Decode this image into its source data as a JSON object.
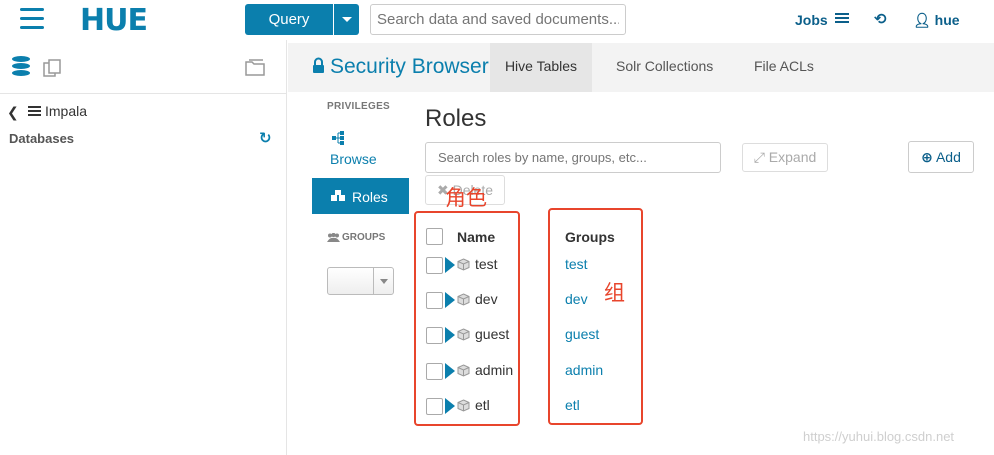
{
  "topbar": {
    "logo_text": "HUE",
    "query_label": "Query",
    "search_placeholder": "Search data and saved documents...",
    "jobs_label": "Jobs",
    "user_label": "hue"
  },
  "leftpanel": {
    "back_label": "Impala",
    "databases_label": "Databases"
  },
  "security": {
    "title": "Security Browser",
    "tabs": [
      {
        "label": "Hive Tables",
        "active": true
      },
      {
        "label": "Solr Collections",
        "active": false
      },
      {
        "label": "File ACLs",
        "active": false
      }
    ]
  },
  "sidenav": {
    "privileges_label": "PRIVILEGES",
    "browse_label": "Browse",
    "roles_label": "Roles",
    "groups_label": "GROUPS",
    "groups_select_value": ""
  },
  "content": {
    "title": "Roles",
    "search_placeholder": "Search roles by name, groups, etc...",
    "expand_label": "Expand",
    "add_label": "Add",
    "delete_label": "Delete",
    "columns": {
      "name": "Name",
      "groups": "Groups"
    },
    "rows": [
      {
        "name": "test",
        "group": "test"
      },
      {
        "name": "dev",
        "group": "dev"
      },
      {
        "name": "guest",
        "group": "guest"
      },
      {
        "name": "admin",
        "group": "admin"
      },
      {
        "name": "etl",
        "group": "etl"
      }
    ]
  },
  "annotations": {
    "roles_cn": "角色",
    "group_cn": "组",
    "accent_color": "#e8452c"
  },
  "watermark": "https://yuhui.blog.csdn.net",
  "colors": {
    "brand": "#0b7fad",
    "link": "#0b5f8a"
  }
}
